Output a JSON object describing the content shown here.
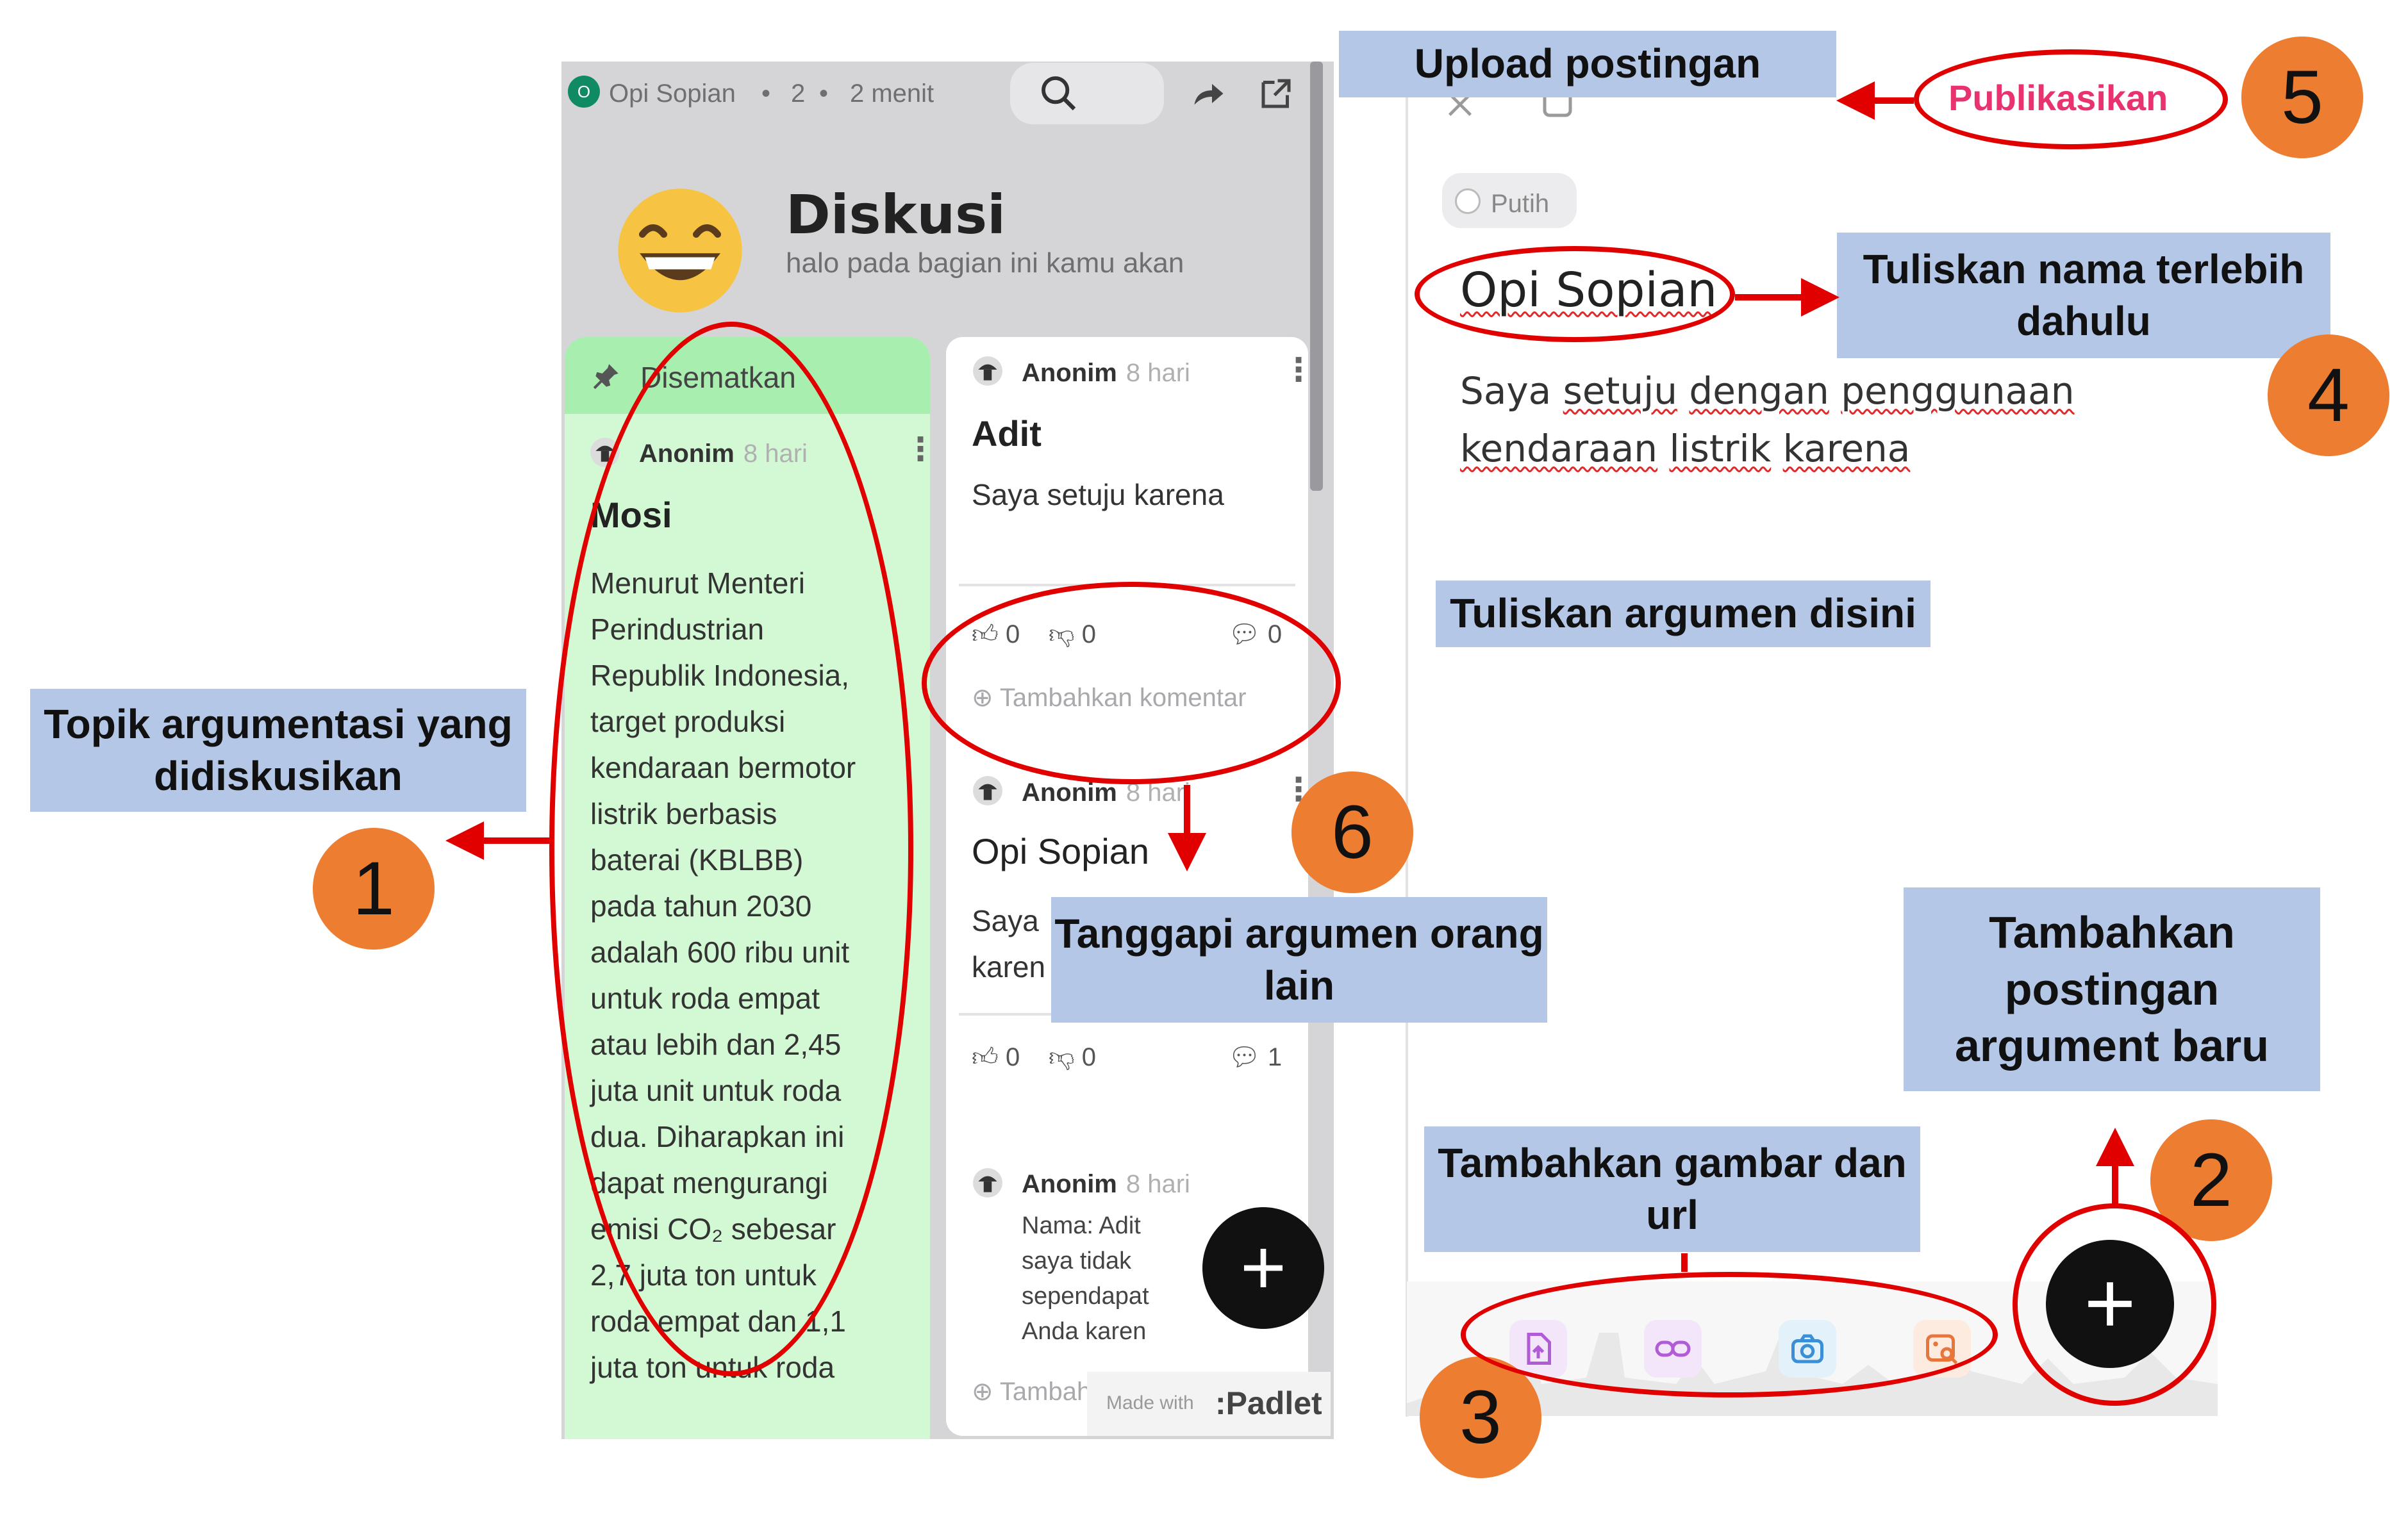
{
  "board": {
    "topbar": {
      "avatar_initial": "O",
      "author": "Opi Sopian",
      "count": "2",
      "time": "2 menit"
    },
    "title": "Diskusi",
    "subtitle": "halo pada bagian ini kamu akan",
    "emoji": "grinning-face-icon",
    "pinned": {
      "header": "Disematkan",
      "author": "Anonim",
      "time": "8 hari",
      "title": "Mosi",
      "body": [
        "Menurut Menteri",
        "Perindustrian",
        "Republik Indonesia,",
        "target produksi",
        "kendaraan bermotor",
        "listrik berbasis",
        "baterai (KBLBB)",
        "pada tahun 2030",
        "adalah 600 ribu unit",
        "untuk roda empat",
        "atau lebih dan 2,45",
        "juta unit untuk roda",
        "dua. Diharapkan ini",
        "dapat mengurangi",
        "emisi CO₂ sebesar",
        "2,7 juta ton untuk",
        "roda empat dan 1,1",
        "juta ton untuk roda"
      ]
    },
    "card_adit": {
      "author": "Anonim",
      "time": "8 hari",
      "title": "Adit",
      "body": "Saya setuju karena",
      "likes": "0",
      "dislikes": "0",
      "comments": "0",
      "add_comment": "Tambahkan komentar"
    },
    "card_opi": {
      "author": "Anonim",
      "time": "8 hari",
      "title": "Opi Sopian",
      "body_line1": "Saya",
      "body_line2": "karen",
      "likes": "0",
      "dislikes": "0",
      "comments": "1",
      "comment": {
        "author": "Anonim",
        "time": "8 hari",
        "lines": [
          "Nama: Adit",
          "saya tidak",
          "sependapat",
          "Anda karen"
        ]
      },
      "add_comment": "Tambahkan komentar"
    },
    "made_with": "Made with",
    "brand": ":Padlet"
  },
  "editor": {
    "color_chip": "Putih",
    "name_value": "Opi Sopian",
    "body_line1": [
      "Saya ",
      "setuju",
      " ",
      "dengan",
      " ",
      "penggunaan"
    ],
    "body_line2": [
      "kendaraan",
      " ",
      "listrik",
      " ",
      "karena"
    ],
    "publish_label": "Publikasikan",
    "attach_icons": [
      "file-upload-icon",
      "link-icon",
      "camera-icon",
      "image-search-icon"
    ]
  },
  "annotations": {
    "upload": "Upload postingan",
    "name_first": "Tuliskan nama terlebih dahulu",
    "write_arg": "Tuliskan argumen disini",
    "topic": "Topik argumentasi yang didiskusikan",
    "respond": "Tanggapi argumen orang lain",
    "add_post": "Tambahkan postingan argument baru",
    "add_media": "Tambahkan gambar dan url",
    "n1": "1",
    "n2": "2",
    "n3": "3",
    "n4": "4",
    "n5": "5",
    "n6": "6"
  },
  "colors": {
    "accent_publish": "#e8336f",
    "annotation_box": "#b4c7e7",
    "number_badge": "#ed7d31",
    "highlight": "#e00000",
    "pinned_card": "#d3f8d4"
  }
}
